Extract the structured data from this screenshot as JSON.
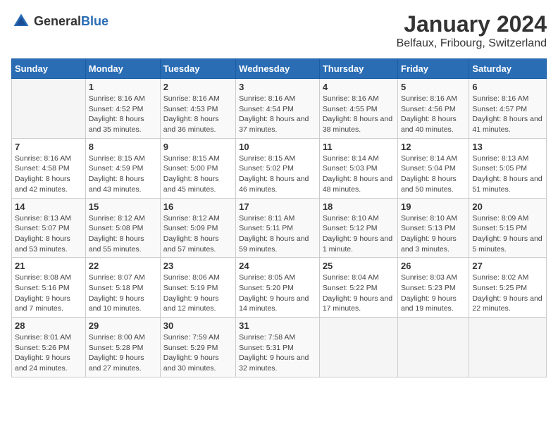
{
  "header": {
    "logo_general": "General",
    "logo_blue": "Blue",
    "title": "January 2024",
    "subtitle": "Belfaux, Fribourg, Switzerland"
  },
  "days_of_week": [
    "Sunday",
    "Monday",
    "Tuesday",
    "Wednesday",
    "Thursday",
    "Friday",
    "Saturday"
  ],
  "weeks": [
    [
      {
        "day": "",
        "sunrise": "",
        "sunset": "",
        "daylight": ""
      },
      {
        "day": "1",
        "sunrise": "Sunrise: 8:16 AM",
        "sunset": "Sunset: 4:52 PM",
        "daylight": "Daylight: 8 hours and 35 minutes."
      },
      {
        "day": "2",
        "sunrise": "Sunrise: 8:16 AM",
        "sunset": "Sunset: 4:53 PM",
        "daylight": "Daylight: 8 hours and 36 minutes."
      },
      {
        "day": "3",
        "sunrise": "Sunrise: 8:16 AM",
        "sunset": "Sunset: 4:54 PM",
        "daylight": "Daylight: 8 hours and 37 minutes."
      },
      {
        "day": "4",
        "sunrise": "Sunrise: 8:16 AM",
        "sunset": "Sunset: 4:55 PM",
        "daylight": "Daylight: 8 hours and 38 minutes."
      },
      {
        "day": "5",
        "sunrise": "Sunrise: 8:16 AM",
        "sunset": "Sunset: 4:56 PM",
        "daylight": "Daylight: 8 hours and 40 minutes."
      },
      {
        "day": "6",
        "sunrise": "Sunrise: 8:16 AM",
        "sunset": "Sunset: 4:57 PM",
        "daylight": "Daylight: 8 hours and 41 minutes."
      }
    ],
    [
      {
        "day": "7",
        "sunrise": "Sunrise: 8:16 AM",
        "sunset": "Sunset: 4:58 PM",
        "daylight": "Daylight: 8 hours and 42 minutes."
      },
      {
        "day": "8",
        "sunrise": "Sunrise: 8:15 AM",
        "sunset": "Sunset: 4:59 PM",
        "daylight": "Daylight: 8 hours and 43 minutes."
      },
      {
        "day": "9",
        "sunrise": "Sunrise: 8:15 AM",
        "sunset": "Sunset: 5:00 PM",
        "daylight": "Daylight: 8 hours and 45 minutes."
      },
      {
        "day": "10",
        "sunrise": "Sunrise: 8:15 AM",
        "sunset": "Sunset: 5:02 PM",
        "daylight": "Daylight: 8 hours and 46 minutes."
      },
      {
        "day": "11",
        "sunrise": "Sunrise: 8:14 AM",
        "sunset": "Sunset: 5:03 PM",
        "daylight": "Daylight: 8 hours and 48 minutes."
      },
      {
        "day": "12",
        "sunrise": "Sunrise: 8:14 AM",
        "sunset": "Sunset: 5:04 PM",
        "daylight": "Daylight: 8 hours and 50 minutes."
      },
      {
        "day": "13",
        "sunrise": "Sunrise: 8:13 AM",
        "sunset": "Sunset: 5:05 PM",
        "daylight": "Daylight: 8 hours and 51 minutes."
      }
    ],
    [
      {
        "day": "14",
        "sunrise": "Sunrise: 8:13 AM",
        "sunset": "Sunset: 5:07 PM",
        "daylight": "Daylight: 8 hours and 53 minutes."
      },
      {
        "day": "15",
        "sunrise": "Sunrise: 8:12 AM",
        "sunset": "Sunset: 5:08 PM",
        "daylight": "Daylight: 8 hours and 55 minutes."
      },
      {
        "day": "16",
        "sunrise": "Sunrise: 8:12 AM",
        "sunset": "Sunset: 5:09 PM",
        "daylight": "Daylight: 8 hours and 57 minutes."
      },
      {
        "day": "17",
        "sunrise": "Sunrise: 8:11 AM",
        "sunset": "Sunset: 5:11 PM",
        "daylight": "Daylight: 8 hours and 59 minutes."
      },
      {
        "day": "18",
        "sunrise": "Sunrise: 8:10 AM",
        "sunset": "Sunset: 5:12 PM",
        "daylight": "Daylight: 9 hours and 1 minute."
      },
      {
        "day": "19",
        "sunrise": "Sunrise: 8:10 AM",
        "sunset": "Sunset: 5:13 PM",
        "daylight": "Daylight: 9 hours and 3 minutes."
      },
      {
        "day": "20",
        "sunrise": "Sunrise: 8:09 AM",
        "sunset": "Sunset: 5:15 PM",
        "daylight": "Daylight: 9 hours and 5 minutes."
      }
    ],
    [
      {
        "day": "21",
        "sunrise": "Sunrise: 8:08 AM",
        "sunset": "Sunset: 5:16 PM",
        "daylight": "Daylight: 9 hours and 7 minutes."
      },
      {
        "day": "22",
        "sunrise": "Sunrise: 8:07 AM",
        "sunset": "Sunset: 5:18 PM",
        "daylight": "Daylight: 9 hours and 10 minutes."
      },
      {
        "day": "23",
        "sunrise": "Sunrise: 8:06 AM",
        "sunset": "Sunset: 5:19 PM",
        "daylight": "Daylight: 9 hours and 12 minutes."
      },
      {
        "day": "24",
        "sunrise": "Sunrise: 8:05 AM",
        "sunset": "Sunset: 5:20 PM",
        "daylight": "Daylight: 9 hours and 14 minutes."
      },
      {
        "day": "25",
        "sunrise": "Sunrise: 8:04 AM",
        "sunset": "Sunset: 5:22 PM",
        "daylight": "Daylight: 9 hours and 17 minutes."
      },
      {
        "day": "26",
        "sunrise": "Sunrise: 8:03 AM",
        "sunset": "Sunset: 5:23 PM",
        "daylight": "Daylight: 9 hours and 19 minutes."
      },
      {
        "day": "27",
        "sunrise": "Sunrise: 8:02 AM",
        "sunset": "Sunset: 5:25 PM",
        "daylight": "Daylight: 9 hours and 22 minutes."
      }
    ],
    [
      {
        "day": "28",
        "sunrise": "Sunrise: 8:01 AM",
        "sunset": "Sunset: 5:26 PM",
        "daylight": "Daylight: 9 hours and 24 minutes."
      },
      {
        "day": "29",
        "sunrise": "Sunrise: 8:00 AM",
        "sunset": "Sunset: 5:28 PM",
        "daylight": "Daylight: 9 hours and 27 minutes."
      },
      {
        "day": "30",
        "sunrise": "Sunrise: 7:59 AM",
        "sunset": "Sunset: 5:29 PM",
        "daylight": "Daylight: 9 hours and 30 minutes."
      },
      {
        "day": "31",
        "sunrise": "Sunrise: 7:58 AM",
        "sunset": "Sunset: 5:31 PM",
        "daylight": "Daylight: 9 hours and 32 minutes."
      },
      {
        "day": "",
        "sunrise": "",
        "sunset": "",
        "daylight": ""
      },
      {
        "day": "",
        "sunrise": "",
        "sunset": "",
        "daylight": ""
      },
      {
        "day": "",
        "sunrise": "",
        "sunset": "",
        "daylight": ""
      }
    ]
  ]
}
